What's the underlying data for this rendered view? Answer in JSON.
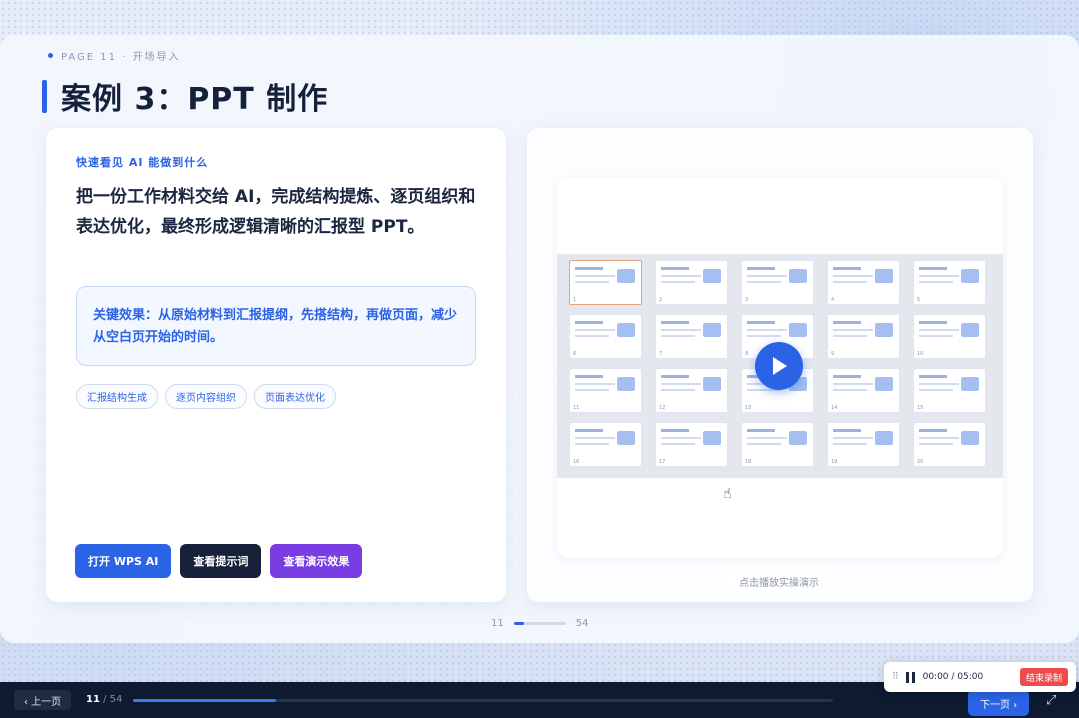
{
  "header": {
    "page_tag": "PAGE 11 · 开场导入",
    "title": "案例 3：PPT 制作"
  },
  "left_panel": {
    "eyebrow": "快速看见 AI 能做到什么",
    "lead": "把一份工作材料交给 AI，完成结构提炼、逐页组织和表达优化，最终形成逻辑清晰的汇报型 PPT。",
    "effect": "关键效果：从原始材料到汇报提纲，先搭结构，再做页面，减少从空白页开始的时间。",
    "tags": [
      "汇报结构生成",
      "逐页内容组织",
      "页面表达优化"
    ],
    "buttons": {
      "open_ai": "打开 WPS AI",
      "view_prompt": "查看提示词",
      "view_demo": "查看演示效果"
    }
  },
  "right_panel": {
    "caption": "点击播放实操演示",
    "thumb_numbers": [
      "1",
      "2",
      "3",
      "4",
      "5",
      "6",
      "7",
      "8",
      "9",
      "10",
      "11",
      "12",
      "13",
      "14",
      "15",
      "16",
      "17",
      "18",
      "19",
      "20"
    ]
  },
  "pager": {
    "current": "11",
    "total": "54"
  },
  "bottom_bar": {
    "prev_label": "‹ 上一页",
    "current_page": "11",
    "total_label": " / 54",
    "next_label": "下一页 ›",
    "progress": 0.204
  },
  "recorder": {
    "time": "00:00 / 05:00",
    "stop_label": "结束录制"
  },
  "colors": {
    "accent": "#2b63e6",
    "navy": "#17213a",
    "purple": "#7a3ce3",
    "stop": "#ef4b4b"
  }
}
